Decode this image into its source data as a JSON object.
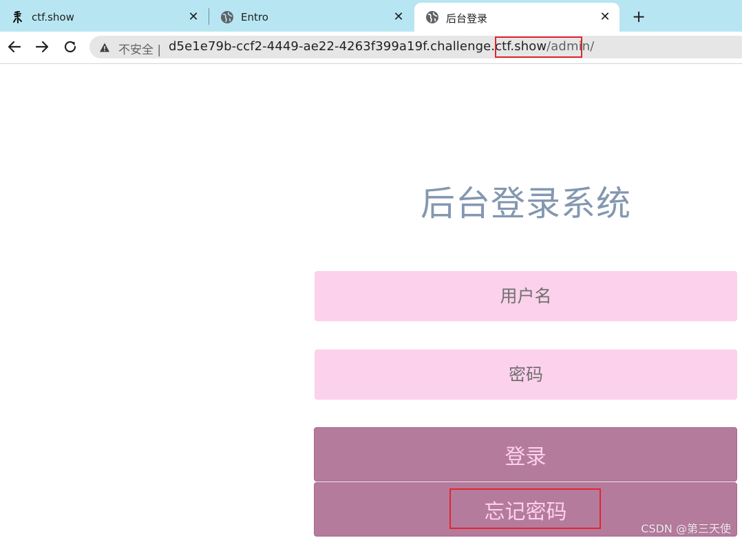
{
  "browser": {
    "tabs": [
      {
        "title": "ctf.show",
        "icon": "ctfshow-logo-icon",
        "active": false
      },
      {
        "title": "Entro",
        "icon": "globe-icon",
        "active": false
      },
      {
        "title": "后台登录",
        "icon": "globe-icon",
        "active": true
      }
    ],
    "close_glyph": "✕",
    "new_tab_glyph": "+",
    "address": {
      "security_label": "不安全",
      "separator": "|",
      "host": "d5e1e79b-ccf2-4449-ae22-4263f399a19f.challenge.ctf.show",
      "path": "/admin/"
    }
  },
  "page": {
    "title": "后台登录系统",
    "username_placeholder": "用户名",
    "password_placeholder": "密码",
    "login_label": "登录",
    "forgot_label": "忘记密码"
  },
  "watermark": "CSDN @第三天使",
  "colors": {
    "tabstrip": "#b7e6f2",
    "field_bg": "#fcd1ec",
    "button_bg": "#b57b9d",
    "title": "#8497b0",
    "highlight": "#e0262c"
  }
}
